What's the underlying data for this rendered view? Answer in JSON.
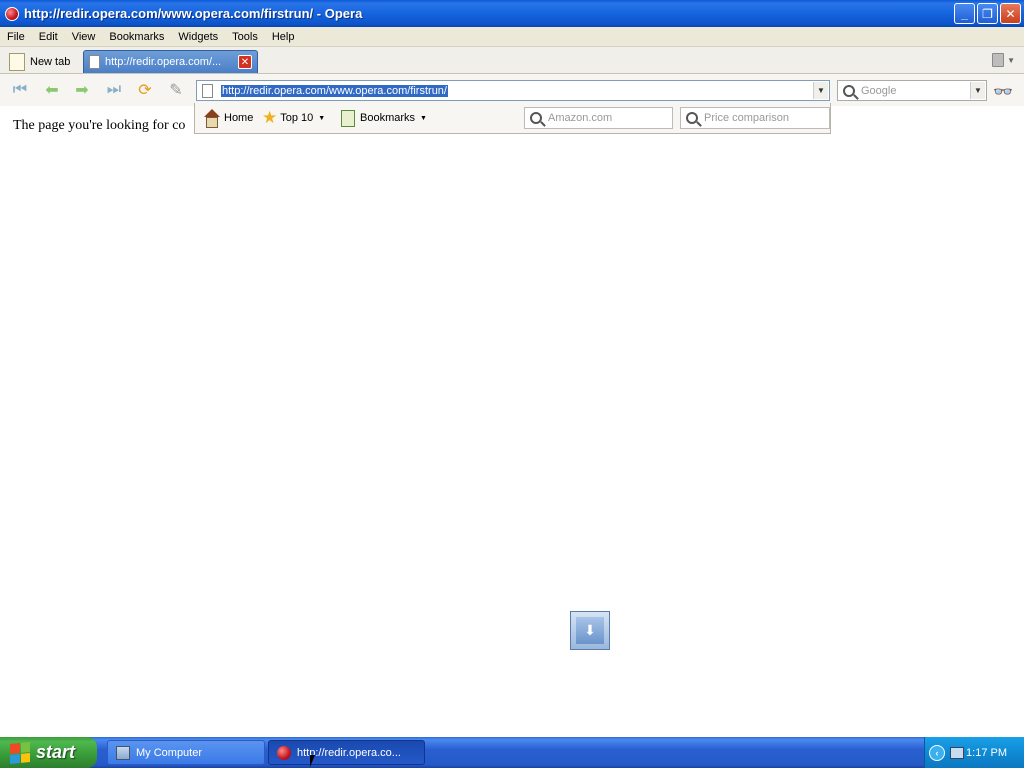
{
  "window": {
    "title": "http://redir.opera.com/www.opera.com/firstrun/ - Opera",
    "minimize": "_",
    "maximize": "❐",
    "close": "✕"
  },
  "menu": [
    "File",
    "Edit",
    "View",
    "Bookmarks",
    "Widgets",
    "Tools",
    "Help"
  ],
  "tabs": {
    "new_tab": "New tab",
    "active_tab": "http://redir.opera.com/...",
    "close_glyph": "✕"
  },
  "address": {
    "url": "http://redir.opera.com/www.opera.com/firstrun/",
    "search_placeholder": "Google"
  },
  "dropdown": {
    "home": "Home",
    "top10": "Top 10",
    "bookmarks": "Bookmarks",
    "search1": "Amazon.com",
    "search2": "Price comparison"
  },
  "page": {
    "text": "The page you're looking for co"
  },
  "taskbar": {
    "start": "start",
    "items": [
      "My Computer",
      "http://redir.opera.co..."
    ],
    "clock": "1:17 PM"
  }
}
